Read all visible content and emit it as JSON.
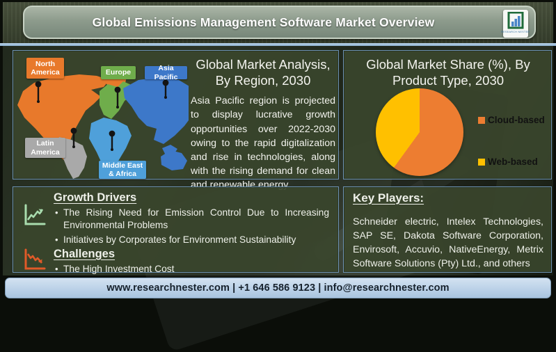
{
  "header": {
    "title": "Global Emissions Management Software Market Overview",
    "logo_text": "RESEARCH NESTER"
  },
  "map_panel": {
    "regions": [
      {
        "label": "North America",
        "color": "#E8792B"
      },
      {
        "label": "Europe",
        "color": "#6FAD4B"
      },
      {
        "label": "Asia Pacific",
        "color": "#3D78C9"
      },
      {
        "label": "Latin America",
        "color": "#A9A9A9"
      },
      {
        "label": "Middle East & Africa",
        "color": "#4FA0DA"
      }
    ]
  },
  "analysis": {
    "title": "Global Market Analysis, By Region, 2030",
    "body": "Asia Pacific region is projected to display lucrative growth opportunities over 2022-2030 owing to the rapid digitalization and rise in technologies, along with the rising demand for clean and renewable energy"
  },
  "chart_data": {
    "type": "pie",
    "title": "Global Market Share (%), By Product Type, 2030",
    "labels": [
      "Cloud-based",
      "Web-based"
    ],
    "values": [
      60,
      40
    ],
    "colors": [
      "#ED7D31",
      "#FFC000"
    ],
    "legend_position": "right",
    "start_angle_deg": 0
  },
  "pie_panel": {
    "title": "Global Market Share (%), By Product Type, 2030"
  },
  "drivers_panel": {
    "drivers_heading": "Growth Drivers",
    "drivers": [
      "The Rising Need for Emission Control Due to Increasing Environmental Problems",
      "Initiatives by Corporates for Environment Sustainability"
    ],
    "challenges_heading": "Challenges",
    "challenges": [
      "The High Investment Cost"
    ],
    "bullet_char": "•"
  },
  "key_players_panel": {
    "heading": "Key Players:",
    "body": "Schneider electric, Intelex Technologies, SAP SE, Dakota Software Corporation, Envirosoft, Accuvio, NativeEnergy, Metrix Software Solutions (Pty) Ltd., and others"
  },
  "footer": {
    "text": "www.researchnester.com | +1 646 586 9123 | info@researchnester.com"
  },
  "theme": {
    "panel_border": "#6D92B3",
    "panel_bg": "#39452D",
    "footer_bg": "#B9D0E7",
    "growth_icon_color": "#A9DCAE",
    "challenge_icon_color": "#E05A28"
  }
}
